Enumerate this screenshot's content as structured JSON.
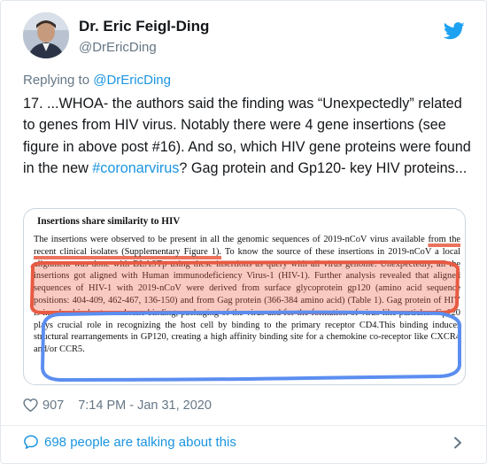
{
  "author": {
    "name": "Dr. Eric Feigl-Ding",
    "handle": "@DrEricDing"
  },
  "reply": {
    "prefix": "Replying to ",
    "mention": "@DrEricDing"
  },
  "tweet": {
    "part1": "17. ...WHOA- the authors said the finding was “Unexpectedly” related to genes from HIV virus. Notably there were 4 gene insertions (see figure in above post #16). And so, which HIV gene proteins were found in the new ",
    "hashtag": "#coronarvirus",
    "part2": "? Gag protein and Gp120- key HIV proteins..."
  },
  "figure": {
    "heading": "Insertions share similarity to HIV",
    "s1": "The insertions were observed to be present in all the genomic sequences of 2019-nCoV virus available ",
    "s2": "from the recent clinical isolates (Supplementary Figure 1).",
    "s3": " To know the source of these ",
    "s4": "insertions in 2019-nCoV a local alignment was done with BLASTp using these insertions as query with all virus genome. Unexpectedly, all the insertions got aligned with Human immunodeficiency Virus-1 (HIV-1). Further analysis revealed that aligned sequences of HIV-1 with 2019-nCoV were derived from surface glycoprotein gp120 (amino acid sequence positions: 404-409, 462-467, 136-150)",
    "s5": " and from Gag protein (366-384 amino acid) (Table 1). Gag protein of HIV is involved in host membrane binding, packaging of the virus and for the formation of virus-like particles. Gp120 plays crucial role in recognizing the host cell by binding to the primary receptor CD4.This binding induces structural rearrangements in GP120, creating a high affinity binding site for a chemokine co-receptor like CXCR4 and/or CCR5."
  },
  "meta": {
    "likes": "907",
    "timestamp": "7:14 PM - Jan 31, 2020"
  },
  "talking": {
    "label": "698 people are talking about this"
  },
  "icons": {
    "brand": "twitter-bird-icon",
    "like": "heart-icon",
    "talk": "speech-bubble-icon",
    "more": "chevron-right-icon"
  },
  "colors": {
    "link": "#1b95e0",
    "secondary": "#657786",
    "text": "#14171a",
    "highlight_red": "#e85a42",
    "highlight_blue": "#5b8ef0"
  }
}
